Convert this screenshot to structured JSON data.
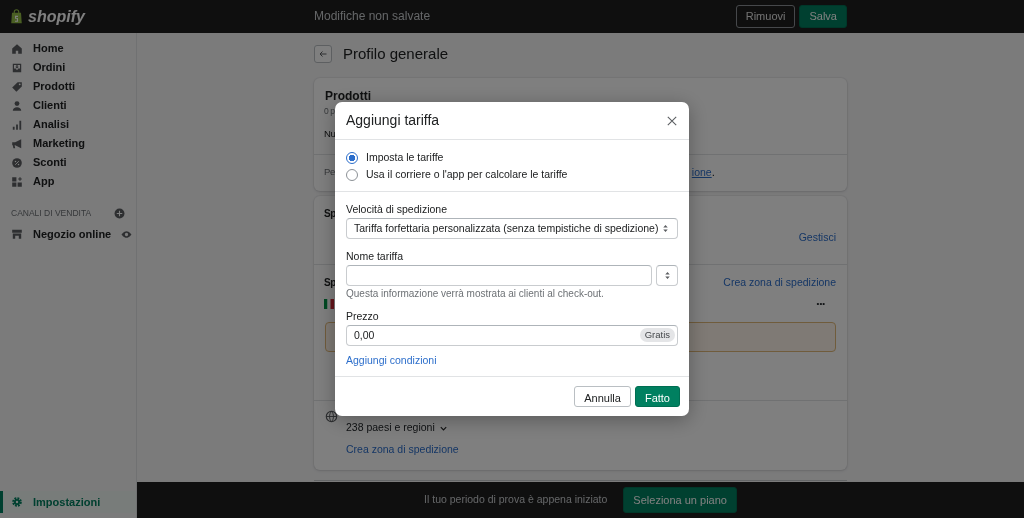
{
  "top_bar": {
    "logo_text": "shopify",
    "title": "Modifiche non salvate",
    "buttons": [
      {
        "label": "Rimuovi",
        "kind": "secondary"
      },
      {
        "label": "Salva",
        "kind": "primary"
      }
    ]
  },
  "sidebar": {
    "items": [
      {
        "label": "Home",
        "selected": false
      },
      {
        "label": "Ordini",
        "selected": false
      },
      {
        "label": "Prodotti",
        "selected": false
      },
      {
        "label": "Clienti",
        "selected": false
      },
      {
        "label": "Analisi",
        "selected": false
      },
      {
        "label": "Marketing",
        "selected": false
      },
      {
        "label": "Sconti",
        "selected": false
      },
      {
        "label": "App",
        "selected": false
      }
    ],
    "sales_channels": {
      "title": "CANALI DI VENDITA",
      "items": [
        {
          "label": "Negozio online"
        }
      ]
    },
    "settings": {
      "label": "Impostazioni",
      "selected": true
    }
  },
  "page": {
    "title": "Profilo generale",
    "products_card": {
      "title": "Prodotti",
      "subtitle": "0 p",
      "line_1": "Nu",
      "line_2": "Pe",
      "link": "ione",
      "link_suffix": "."
    },
    "shipping_card": {
      "heading_1": "Sp",
      "manage_link": "Gestisci",
      "heading_2": "Sp",
      "create_zone_link": "Crea zona di spedizione",
      "more_button": "•••",
      "countries": "238 paesi e regioni",
      "create_zone_link_2": "Crea zona di spedizione"
    }
  },
  "modal": {
    "title": "Aggiungi tariffa",
    "rate_options": [
      {
        "label": "Imposta le tariffe",
        "selected": true
      },
      {
        "label": "Usa il corriere o l'app per calcolare le tariffe",
        "selected": false
      }
    ],
    "speed": {
      "label": "Velocità di spedizione",
      "value": "Tariffa forfettaria personalizzata (senza tempistiche di spedizione)"
    },
    "rate_name": {
      "label": "Nome tariffa",
      "help": "Questa informazione verrà mostrata ai clienti al check-out."
    },
    "price": {
      "label": "Prezzo",
      "value": "0,00",
      "badge": "Gratis"
    },
    "add_conditions_link": "Aggiungi condizioni",
    "buttons": [
      {
        "label": "Annulla",
        "kind": "secondary"
      },
      {
        "label": "Fatto",
        "kind": "primary"
      }
    ]
  },
  "bottom_bar": {
    "text": "Il tuo periodo di prova è appena iniziato",
    "button": "Seleziona un piano"
  }
}
